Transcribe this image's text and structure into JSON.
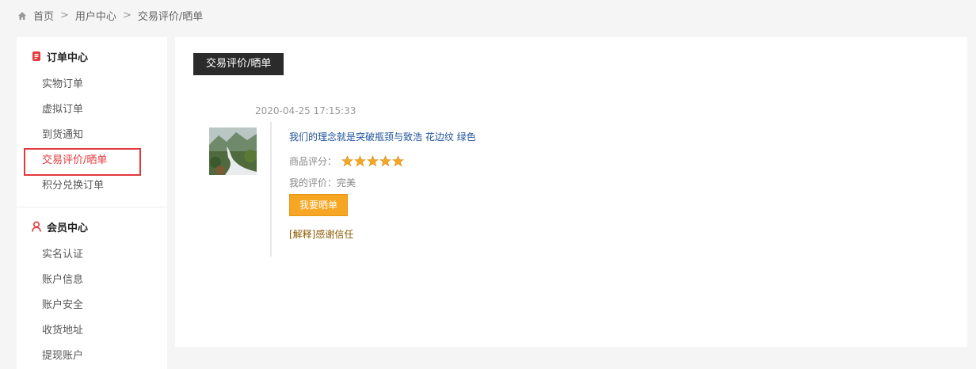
{
  "breadcrumb": {
    "items": [
      "首页",
      "用户中心",
      "交易评价/晒单"
    ],
    "separator": ">"
  },
  "sidebar": {
    "sections": [
      {
        "title": "订单中心",
        "icon": "order-doc-icon",
        "items": [
          "实物订单",
          "虚拟订单",
          "到货通知",
          "交易评价/晒单",
          "积分兑换订单"
        ],
        "active_index": 3
      },
      {
        "title": "会员中心",
        "icon": "user-icon",
        "items": [
          "实名认证",
          "账户信息",
          "账户安全",
          "收货地址",
          "提现账户"
        ]
      }
    ]
  },
  "main": {
    "tab_title": "交易评价/晒单",
    "review": {
      "date": "2020-04-25 17:15:33",
      "product_name": "我们的理念就是突破瓶颈与致浩 花边纹 绿色",
      "rating_label": "商品评分：",
      "rating": 5,
      "rating_max": 5,
      "my_review": "我的评价：完美",
      "share_button": "我要晒单",
      "explanation": "[解释]感谢信任"
    }
  },
  "colors": {
    "accent_red": "#e4393c",
    "button_orange": "#f6a623",
    "link_blue": "#20549b",
    "star_gold": "#f5a623"
  }
}
